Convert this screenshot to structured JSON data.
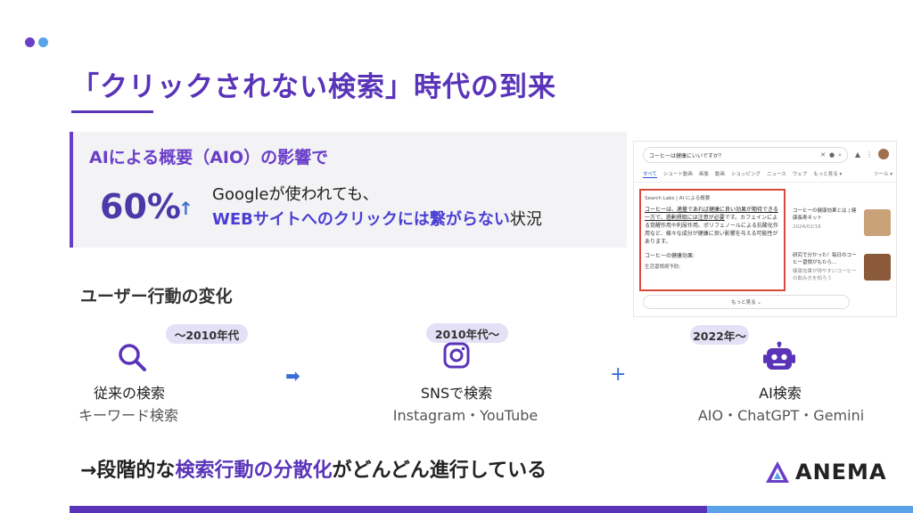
{
  "slide": {
    "title": "「クリックされない検索」時代の到来",
    "colors": {
      "accent_purple": "#5a34b8",
      "accent_blue": "#3a6fd8",
      "light_blue": "#5ba3e8",
      "pill_bg": "#e5e0f6",
      "highlight_red": "#d94a3a"
    }
  },
  "info": {
    "heading": "AIによる概要（AIO）の影響で",
    "percent": "60%",
    "arrow": "↑",
    "line1": "Googleが使われても、",
    "line2_highlight": "WEBサイトへのクリックには繋がらない",
    "line2_rest": "状況"
  },
  "screenshot": {
    "query": "コーヒーは健康にいいですか？",
    "tabs": [
      "すべて",
      "ショート動画",
      "画像",
      "動画",
      "ショッピング",
      "ニュース",
      "ウェブ",
      "もっと見る ▾",
      "ツール ▾"
    ],
    "aio_label": "Search Labs | AI による概要",
    "aio_text_u": "コーヒーは、適量であれば健康に良い効果が期待できる一方で、過剰摂取には注意が必要",
    "aio_text_rest": "です。カフェインによる覚醒作用や利尿作用、ポリフェノールによる抗酸化作用など、様々な成分が健康に良い影響を与える可能性があります。",
    "aio_sub": "コーヒーの健康効果:",
    "aio_sub2": "生活習慣病予防:",
    "card1_title": "コーヒーの健康効果とは | 健康長寿ネット",
    "card1_meta": "2024/02/16",
    "card2_title": "研究で分かった！毎日のコーヒー習慣がもたら...",
    "card2_meta": "健康効果が得やすいコーヒーの飲み方を知ろう",
    "more_label": "もっと見る ⌄"
  },
  "behavior": {
    "heading": "ユーザー行動の変化",
    "stages": [
      {
        "period": "〜2010年代",
        "label": "従来の検索",
        "sub": "キーワード検索",
        "icon": "search-icon"
      },
      {
        "period": "2010年代〜",
        "label": "SNSで検索",
        "sub": "Instagram・YouTube",
        "icon": "instagram-icon"
      },
      {
        "period": "2022年〜",
        "label": "AI検索",
        "sub": "AIO・ChatGPT・Gemini",
        "icon": "robot-icon"
      }
    ],
    "arrow": "➡",
    "plus": "+"
  },
  "conclusion": {
    "prefix": "→段階的な",
    "highlight": "検索行動の分散化",
    "suffix": "がどんどん進行している"
  },
  "brand": {
    "name": "ANEMA"
  }
}
